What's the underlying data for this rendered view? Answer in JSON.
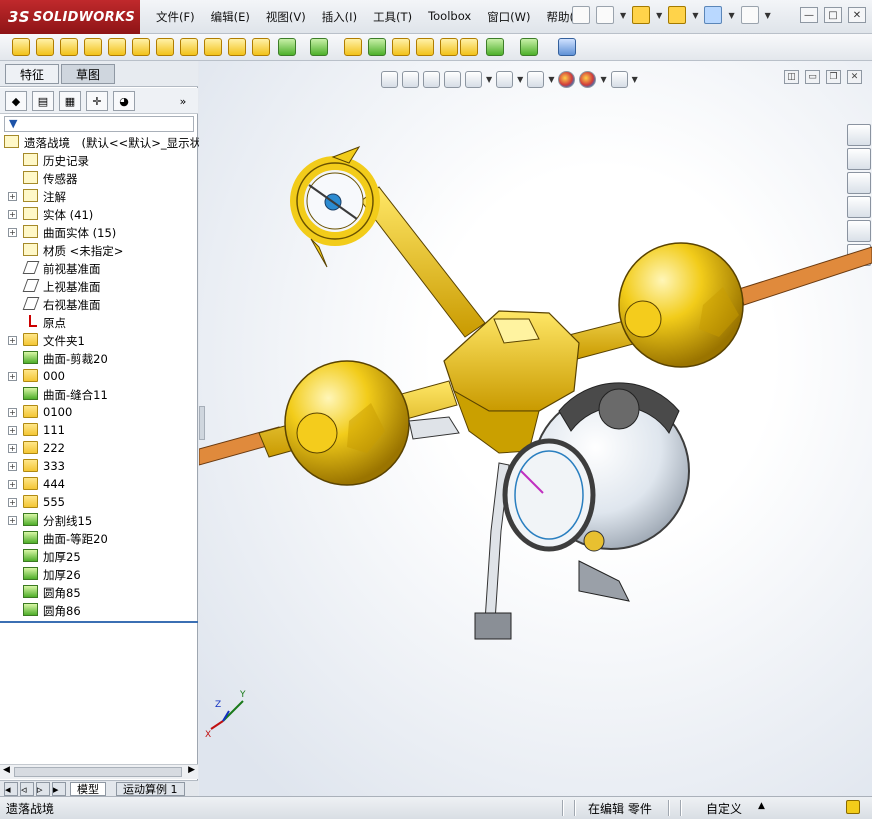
{
  "app": {
    "brand": "SOLIDWORKS",
    "brand_prefix": "3S"
  },
  "menu": [
    "文件(F)",
    "编辑(E)",
    "视图(V)",
    "插入(I)",
    "工具(T)",
    "Toolbox",
    "窗口(W)",
    "帮助(H)"
  ],
  "panel_tabs": [
    "特征",
    "草图"
  ],
  "panel_tools_more": "»",
  "tree": {
    "root": "遗落战境　(默认<<默认>_显示状",
    "items": [
      {
        "label": "历史记录",
        "icon": "history-icon",
        "expander": false
      },
      {
        "label": "传感器",
        "icon": "sensor-icon",
        "expander": false
      },
      {
        "label": "注解",
        "icon": "annotation-icon",
        "expander": true
      },
      {
        "label": "实体 (41)",
        "icon": "solid-bodies-icon",
        "expander": true
      },
      {
        "label": "曲面实体 (15)",
        "icon": "surface-bodies-icon",
        "expander": true
      },
      {
        "label": "材质 <未指定>",
        "icon": "material-icon",
        "expander": false
      },
      {
        "label": "前视基准面",
        "icon": "plane-icon",
        "expander": false
      },
      {
        "label": "上视基准面",
        "icon": "plane-icon",
        "expander": false
      },
      {
        "label": "右视基准面",
        "icon": "plane-icon",
        "expander": false
      },
      {
        "label": "原点",
        "icon": "origin-icon",
        "expander": false
      },
      {
        "label": "文件夹1",
        "icon": "folder-icon",
        "expander": true
      },
      {
        "label": "曲面-剪裁20",
        "icon": "surface-trim-icon",
        "expander": false
      },
      {
        "label": "000",
        "icon": "folder-icon",
        "expander": true
      },
      {
        "label": "曲面-缝合11",
        "icon": "surface-knit-icon",
        "expander": false
      },
      {
        "label": "0100",
        "icon": "folder-icon",
        "expander": true
      },
      {
        "label": "111",
        "icon": "folder-icon",
        "expander": true
      },
      {
        "label": "222",
        "icon": "folder-icon",
        "expander": true
      },
      {
        "label": "333",
        "icon": "folder-icon",
        "expander": true
      },
      {
        "label": "444",
        "icon": "folder-icon",
        "expander": true
      },
      {
        "label": "555",
        "icon": "folder-icon",
        "expander": true
      },
      {
        "label": "分割线15",
        "icon": "split-line-icon",
        "expander": true
      },
      {
        "label": "曲面-等距20",
        "icon": "surface-offset-icon",
        "expander": false
      },
      {
        "label": "加厚25",
        "icon": "thicken-icon",
        "expander": false
      },
      {
        "label": "加厚26",
        "icon": "thicken-icon",
        "expander": false
      },
      {
        "label": "圆角85",
        "icon": "fillet-icon",
        "expander": false
      },
      {
        "label": "圆角86",
        "icon": "fillet-icon",
        "expander": false
      }
    ]
  },
  "bottom_tabs": [
    "模型",
    "运动算例 1"
  ],
  "status": {
    "left": "遗落战境",
    "mode": "在编辑  零件",
    "custom": "自定义"
  },
  "triad": {
    "x": "X",
    "y": "Y",
    "z": "Z"
  },
  "colors": {
    "brand_red": "#b0201f",
    "model_yellow": "#f4cc1c",
    "model_orange": "#e08a3c",
    "model_dark": "#3d3d3d"
  }
}
